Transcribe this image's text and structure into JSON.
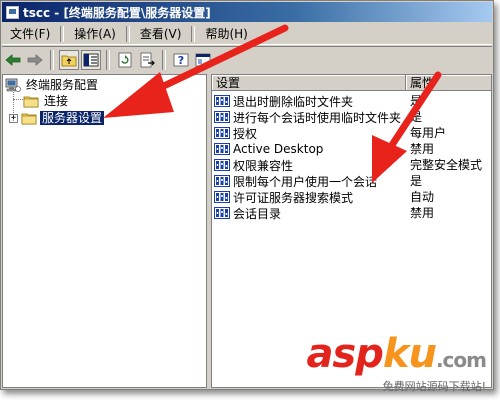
{
  "window": {
    "title": "tscc - [终端服务配置\\服务器设置]"
  },
  "menu": {
    "items": [
      "文件(F)",
      "操作(A)",
      "查看(V)",
      "帮助(H)"
    ]
  },
  "toolbar": {
    "icons": [
      "back-arrow-icon",
      "forward-arrow-icon",
      "up-folder-icon",
      "show-tree-icon",
      "refresh-icon",
      "export-icon",
      "help-icon",
      "console-icon"
    ]
  },
  "tree": {
    "root_label": "终端服务配置",
    "child_connections": "连接",
    "child_server_settings": "服务器设置",
    "expander_symbol": "+"
  },
  "list": {
    "columns": [
      "设置",
      "属性"
    ],
    "rows": [
      {
        "name": "退出时删除临时文件夹",
        "value": "是"
      },
      {
        "name": "进行每个会话时使用临时文件夹",
        "value": "是"
      },
      {
        "name": "授权",
        "value": "每用户"
      },
      {
        "name": "Active Desktop",
        "value": "禁用"
      },
      {
        "name": "权限兼容性",
        "value": "完整安全模式"
      },
      {
        "name": "限制每个用户使用一个会话",
        "value": "是"
      },
      {
        "name": "许可证服务器搜索模式",
        "value": "自动"
      },
      {
        "name": "会话目录",
        "value": "禁用"
      }
    ]
  },
  "watermark": {
    "brand_part1": "asp",
    "brand_part2": "ku",
    "brand_part3": ".com",
    "subtitle": "免费网站源码下载站!"
  },
  "colors": {
    "titlebar_start": "#0a246a",
    "selection": "#0a246a",
    "annotation_arrow": "#e8231c"
  }
}
